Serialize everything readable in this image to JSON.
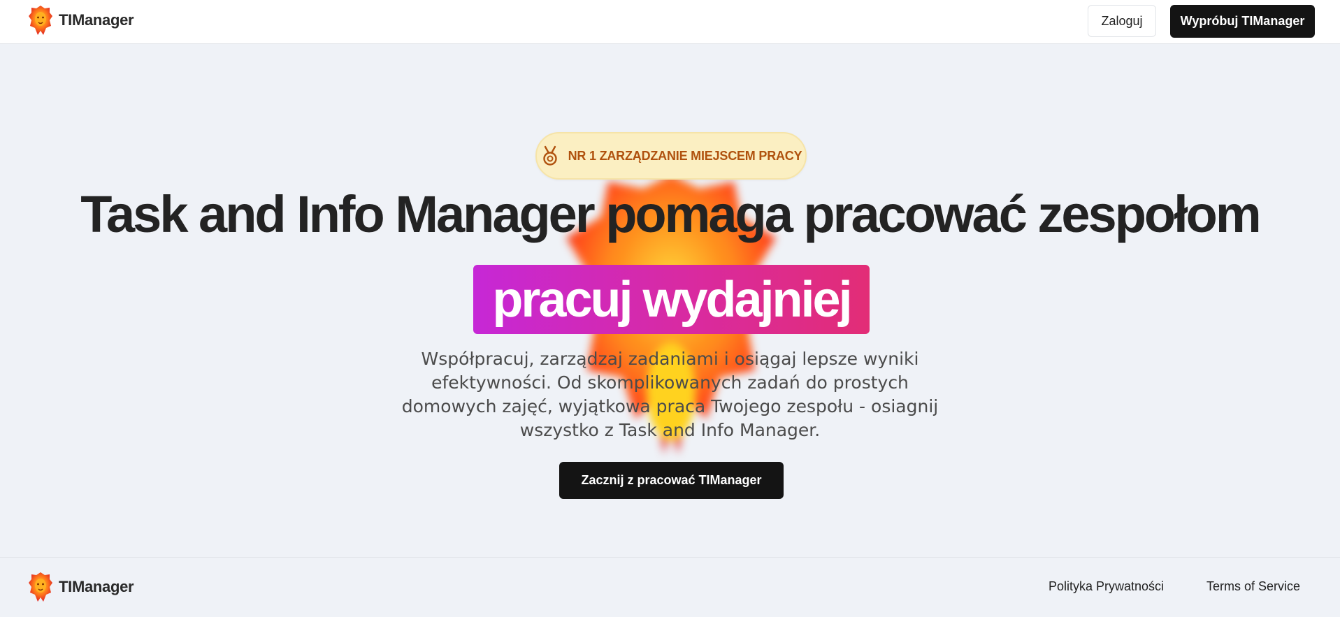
{
  "header": {
    "brand_name": "TIManager",
    "login_label": "Zaloguj",
    "try_label": "Wypróbuj TIManager"
  },
  "hero": {
    "badge_text": "NR 1 ZARZĄDZANIE MIEJSCEM PRACY",
    "badge_icon": "medal-icon",
    "headline": "Task and Info Manager pomaga pracować zespołom",
    "highlight": "pracuj wydajniej",
    "lead": "Współpracuj, zarządzaj zadaniami i osiągaj lepsze wyniki efektywności. Od skomplikowanych zadań do prostych domowych zajęć, wyjątkowa praca Twojego zespołu - osiagnij wszystko z Task and Info Manager.",
    "cta_label": "Zacznij z pracować TIManager"
  },
  "footer": {
    "brand_name": "TIManager",
    "privacy_label": "Polityka Prywatności",
    "terms_label": "Terms of Service"
  },
  "colors": {
    "page_bg": "#eff2f7",
    "dark_button": "#141414",
    "badge_bg": "#fbefc2",
    "badge_text": "#b0520e",
    "highlight_start": "#c628d6",
    "highlight_end": "#e22d76"
  }
}
